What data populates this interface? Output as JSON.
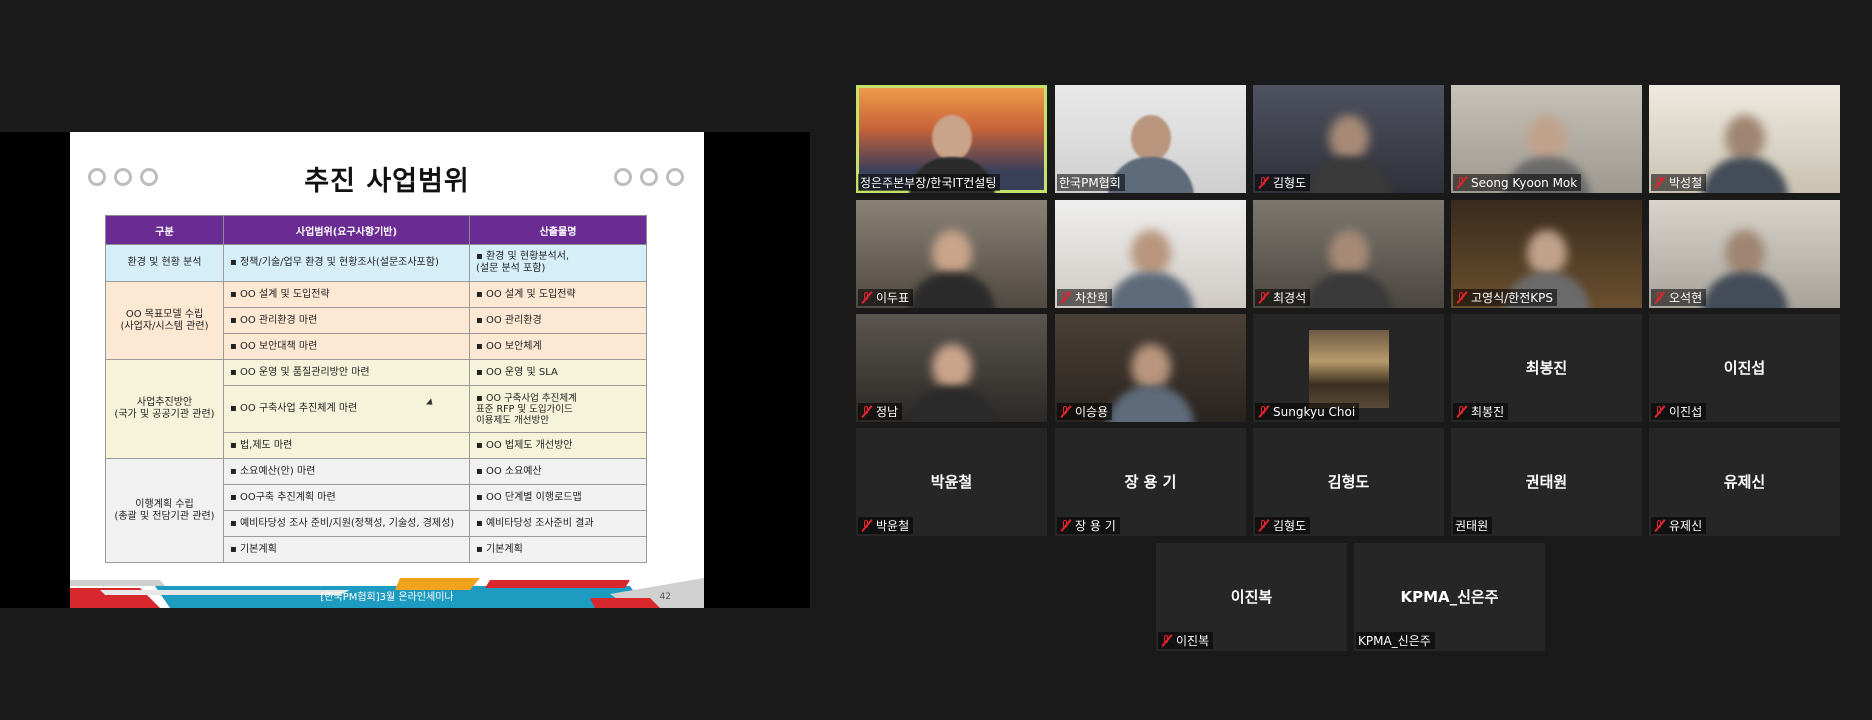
{
  "slide": {
    "title": "추진 사업범위",
    "headers": [
      "구분",
      "사업범위(요구사항기반)",
      "산출물명"
    ],
    "groups": {
      "env": "환경 및 현황 분석",
      "target": "OO 목표모델 수립\n(사업자/시스템 관련)",
      "strategy": "사업추진방안\n(국가 및 공공기관 관련)",
      "plan": "이행계획 수립\n(총괄 및 전담기관 관련)"
    },
    "rows": [
      {
        "scope": "정책/기술/업무 환경 및 현황조사(설문조사포함)",
        "output": "환경 및 현황분석서,\n(설문 분석 포함)"
      },
      {
        "scope": "OO 설계 및 도입전략",
        "output": "OO 설계 및 도입전략"
      },
      {
        "scope": "OO 관리환경 마련",
        "output": "OO 관리환경"
      },
      {
        "scope": "OO 보안대책 마련",
        "output": "OO 보안체계"
      },
      {
        "scope": "OO 운영 및 품질관리방안 마련",
        "output": "OO 운영 및 SLA"
      },
      {
        "scope": "OO 구축사업 추진체계 마련",
        "output": "OO 구축사업 추진체계\n표준 RFP 및 도입가이드\n이용제도 개선방안"
      },
      {
        "scope": "법,제도 마련",
        "output": "OO 법제도 개선방안"
      },
      {
        "scope": "소요예산(안) 마련",
        "output": "OO 소요예산"
      },
      {
        "scope": "OO구축 추진계획 마련",
        "output": "OO 단계별 이행로드맵"
      },
      {
        "scope": "예비타당성 조사 준비/지원(정책성, 기술성, 경제성)",
        "output": "예비타당성 조사준비 결과"
      },
      {
        "scope": "기본계획",
        "output": "기본계획"
      }
    ],
    "footer": "[한국PM협회]3월 온라인세미나",
    "page": "42"
  },
  "participants": [
    {
      "label": "정은주본부장/한국IT컨설팅",
      "muted": false,
      "active": true,
      "video": true
    },
    {
      "label": "한국PM협회",
      "muted": false,
      "active": false,
      "video": true
    },
    {
      "label": "김형도",
      "muted": true,
      "active": false,
      "video": true
    },
    {
      "label": "Seong Kyoon Mok",
      "muted": true,
      "active": false,
      "video": true
    },
    {
      "label": "박성철",
      "muted": true,
      "active": false,
      "video": true
    },
    {
      "label": "이두표",
      "muted": true,
      "active": false,
      "video": true
    },
    {
      "label": "차찬희",
      "muted": true,
      "active": false,
      "video": true
    },
    {
      "label": "최경석",
      "muted": true,
      "active": false,
      "video": true
    },
    {
      "label": "고영식/한전KPS",
      "muted": true,
      "active": false,
      "video": true
    },
    {
      "label": "오석현",
      "muted": true,
      "active": false,
      "video": true
    },
    {
      "label": "정남",
      "muted": true,
      "active": false,
      "video": true
    },
    {
      "label": "이승용",
      "muted": true,
      "active": false,
      "video": true
    },
    {
      "label": "Sungkyu Choi",
      "muted": true,
      "active": false,
      "video": false,
      "photo": true
    },
    {
      "label": "최봉진",
      "name": "최봉진",
      "muted": true,
      "active": false,
      "video": false
    },
    {
      "label": "이진섭",
      "name": "이진섭",
      "muted": true,
      "active": false,
      "video": false
    },
    {
      "label": "박윤철",
      "name": "박윤철",
      "muted": true,
      "active": false,
      "video": false
    },
    {
      "label": "장 용 기",
      "name": "장 용 기",
      "muted": true,
      "active": false,
      "video": false
    },
    {
      "label": "김형도",
      "name": "김형도",
      "muted": true,
      "active": false,
      "video": false
    },
    {
      "label": "권태원",
      "name": "권태원",
      "muted": false,
      "active": false,
      "video": false
    },
    {
      "label": "유제신",
      "name": "유제신",
      "muted": true,
      "active": false,
      "video": false
    },
    {
      "label": "이진복",
      "name": "이진복",
      "muted": true,
      "active": false,
      "video": false
    },
    {
      "label": "KPMA_신은주",
      "name": "KPMA_신은주",
      "muted": false,
      "active": false,
      "video": false
    }
  ],
  "colors": {
    "header": "#6a2b93",
    "active_border": "#c4e26b",
    "mute_icon": "#e0232d"
  }
}
